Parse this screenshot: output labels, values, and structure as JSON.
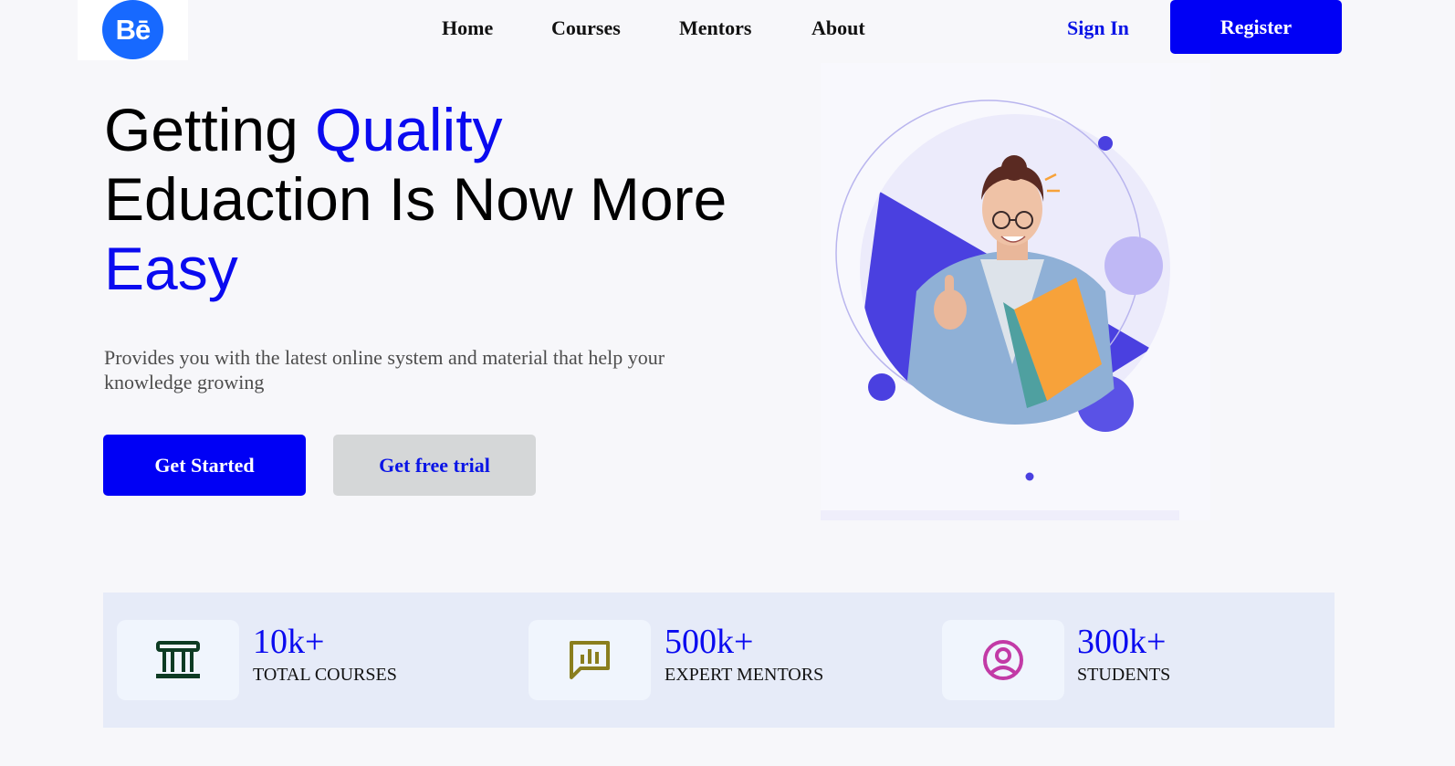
{
  "brand": {
    "logo_text": "Bē",
    "logo_color": "#1769ff"
  },
  "nav": {
    "items": [
      {
        "label": "Home"
      },
      {
        "label": "Courses"
      },
      {
        "label": "Mentors"
      },
      {
        "label": "About"
      }
    ],
    "signin_label": "Sign In",
    "register_label": "Register"
  },
  "hero": {
    "title_part1": "Getting ",
    "title_highlight1": "Quality",
    "title_part2": "Eduaction Is Now More",
    "title_highlight2": "Easy",
    "subtitle": "Provides you with the latest online system and material that help your knowledge growing",
    "primary_button": "Get Started",
    "secondary_button": "Get free trial"
  },
  "stats": [
    {
      "value": "10k+",
      "label": "TOTAL COURSES",
      "icon": "building-columns-icon",
      "icon_color": "#0d3b23"
    },
    {
      "value": "500k+",
      "label": "EXPERT MENTORS",
      "icon": "chat-chart-icon",
      "icon_color": "#8a7e1e"
    },
    {
      "value": "300k+",
      "label": "STUDENTS",
      "icon": "user-circle-icon",
      "icon_color": "#c23aa6"
    }
  ],
  "colors": {
    "accent": "#0000f5",
    "highlight_text": "#0a0af0",
    "background": "#f7f7fa",
    "stats_background": "#e6ebf8"
  }
}
